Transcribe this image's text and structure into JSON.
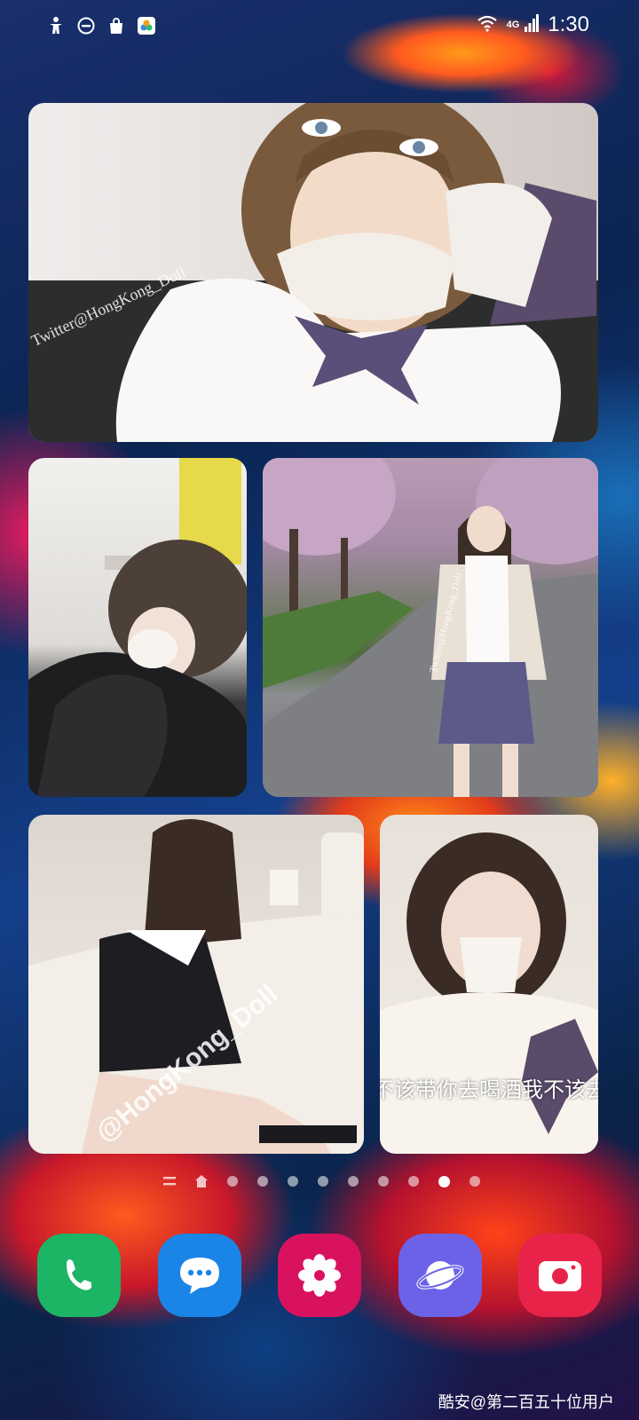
{
  "status_bar": {
    "time": "1:30",
    "network": "4G",
    "left_icons": [
      "accessibility-icon",
      "do-not-disturb-icon",
      "shopping-bag-icon",
      "app-notification-icon"
    ],
    "right_icons": [
      "wifi-icon",
      "signal-icon"
    ]
  },
  "photos": [
    {
      "id": "photo-1",
      "watermark": "Twitter@HongKong_Doll"
    },
    {
      "id": "photo-2",
      "watermark": ""
    },
    {
      "id": "photo-3",
      "watermark": "Twitter@HongKong_Doll"
    },
    {
      "id": "photo-4",
      "watermark": "@HongKong_Doll"
    },
    {
      "id": "photo-5",
      "caption": "不该带你去喝酒我不该去扌"
    }
  ],
  "pager": {
    "pages": 9,
    "active_index": 8
  },
  "dock": [
    {
      "name": "Phone",
      "icon": "phone-icon",
      "color": "#1cb465"
    },
    {
      "name": "Messages",
      "icon": "message-icon",
      "color": "#1a85e6"
    },
    {
      "name": "Gallery",
      "icon": "flower-icon",
      "color": "#d8125f"
    },
    {
      "name": "Internet",
      "icon": "planet-icon",
      "color": "#6b62e8"
    },
    {
      "name": "Camera",
      "icon": "camera-icon",
      "color": "#e8234a"
    }
  ],
  "watermark_credit": "酷安@第二百五十位用户"
}
